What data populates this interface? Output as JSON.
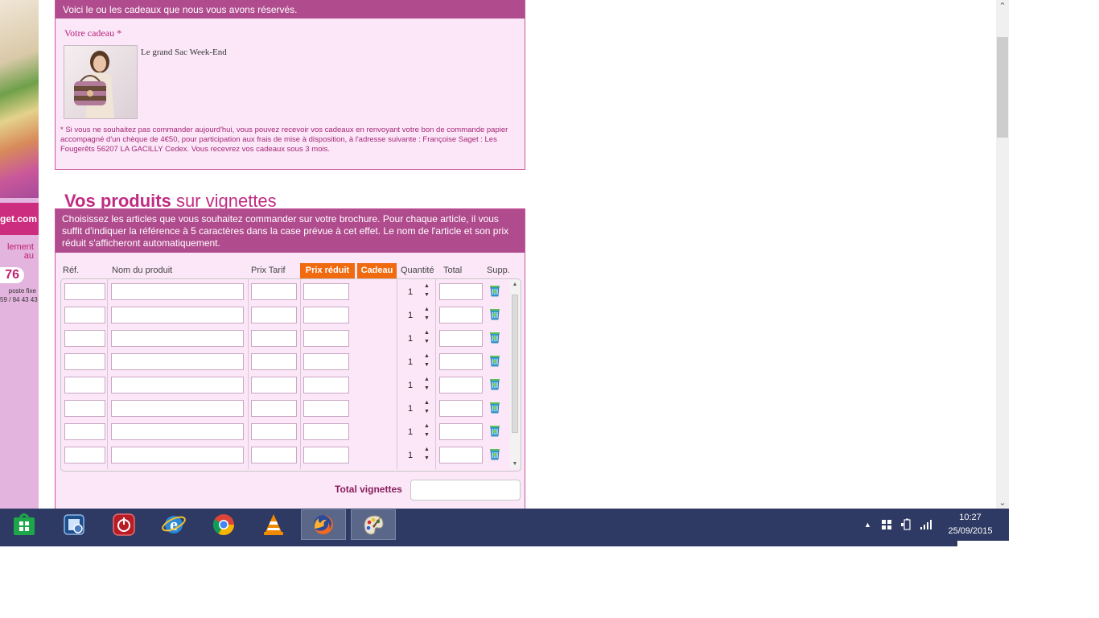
{
  "gift": {
    "header": "Voici le ou les cadeaux que nous vous avons réservés.",
    "label": "Votre cadeau *",
    "name": "Le grand Sac Week-End",
    "note": "* Si vous ne souhaitez pas commander aujourd'hui, vous pouvez recevoir vos cadeaux en renvoyant votre bon de commande papier accompagné d'un chèque de 4€50, pour participation aux frais de mise à disposition, à l'adresse suivante : Françoise Saget : Les Fougerêts 56207 LA GACILLY Cedex. Vous recevrez vos cadeaux sous 3 mois."
  },
  "left_sidebar": {
    "brand": "get.com",
    "promo_line1": "lement",
    "promo_line2": "au",
    "phone": "76",
    "phone_sub1": "poste fixe",
    "phone_sub2": "59 / 84 43 43"
  },
  "section": {
    "title_bold": "Vos produits",
    "title_light": " sur vignettes",
    "instructions": "Choisissez les articles que vous souhaitez commander sur votre brochure. Pour chaque article, il vous suffit d'indiquer la référence à 5 caractères dans la case prévue à cet effet. Le nom de l'article et son prix réduit s'afficheront automatiquement."
  },
  "table": {
    "columns": {
      "ref": "Réf.",
      "name": "Nom du produit",
      "list_price": "Prix Tarif",
      "reduced_price": "Prix réduit",
      "gift": "Cadeau",
      "quantity": "Quantité",
      "total": "Total",
      "delete": "Supp."
    },
    "rows": [
      {
        "quantity": "1"
      },
      {
        "quantity": "1"
      },
      {
        "quantity": "1"
      },
      {
        "quantity": "1"
      },
      {
        "quantity": "1"
      },
      {
        "quantity": "1"
      },
      {
        "quantity": "1"
      },
      {
        "quantity": "1"
      }
    ],
    "total_label": "Total vignettes"
  },
  "taskbar": {
    "apps": [
      "windows-store",
      "system-tool",
      "power-app",
      "internet-explorer",
      "chrome",
      "vlc",
      "firefox",
      "paint"
    ],
    "active_app": "firefox",
    "time": "10:27",
    "date": "25/09/2015"
  },
  "colors": {
    "header_bg": "#b04c8e",
    "panel_bg": "#fbe7f8",
    "accent": "#c12b82",
    "orange": "#f06a10",
    "taskbar": "#2e3a63"
  }
}
